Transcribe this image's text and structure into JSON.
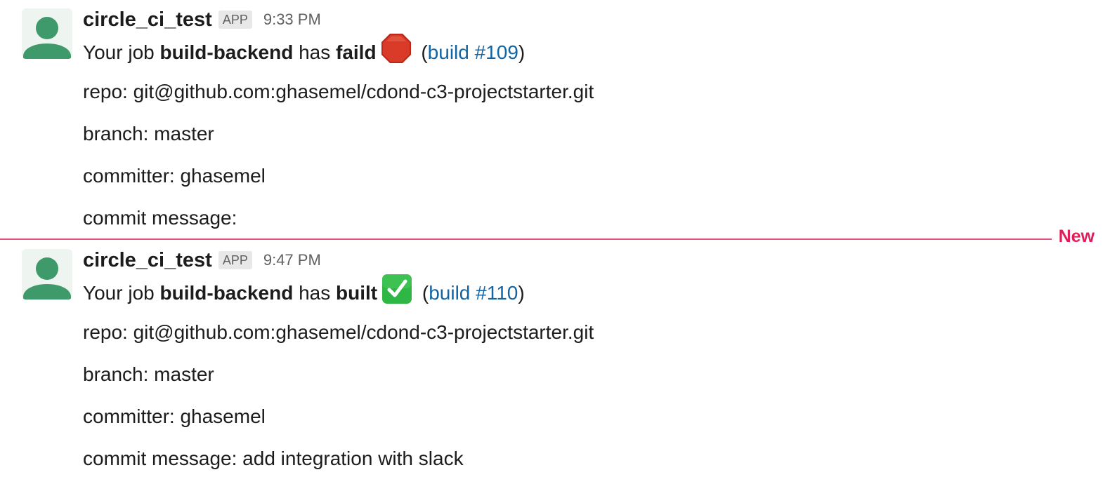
{
  "messages": [
    {
      "username": "circle_ci_test",
      "badge": "APP",
      "time": "9:33 PM",
      "main": {
        "prefix": "Your job ",
        "job": "build-backend",
        "middle": " has ",
        "status": "faild",
        "status_icon": "stop-sign-icon",
        "paren_open": " (",
        "build_link": "build #109",
        "paren_close": ")"
      },
      "repo": "repo: git@github.com:ghasemel/cdond-c3-projectstarter.git",
      "branch": "branch: master",
      "committer": "committer: ghasemel",
      "commit_message": "commit message:"
    },
    {
      "username": "circle_ci_test",
      "badge": "APP",
      "time": "9:47 PM",
      "main": {
        "prefix": "Your job ",
        "job": "build-backend",
        "middle": " has ",
        "status": "built",
        "status_icon": "check-mark-icon",
        "paren_open": " (",
        "build_link": "build #110",
        "paren_close": ")"
      },
      "repo": "repo: git@github.com:ghasemel/cdond-c3-projectstarter.git",
      "branch": "branch: master",
      "committer": "committer: ghasemel",
      "commit_message": "commit message: add integration with slack"
    }
  ],
  "divider": {
    "label": "New",
    "color": "#e01e5a"
  },
  "colors": {
    "link": "#1264a3",
    "avatar": "#3e9a6a",
    "success": "#2eb745",
    "failure": "#d4351c"
  }
}
